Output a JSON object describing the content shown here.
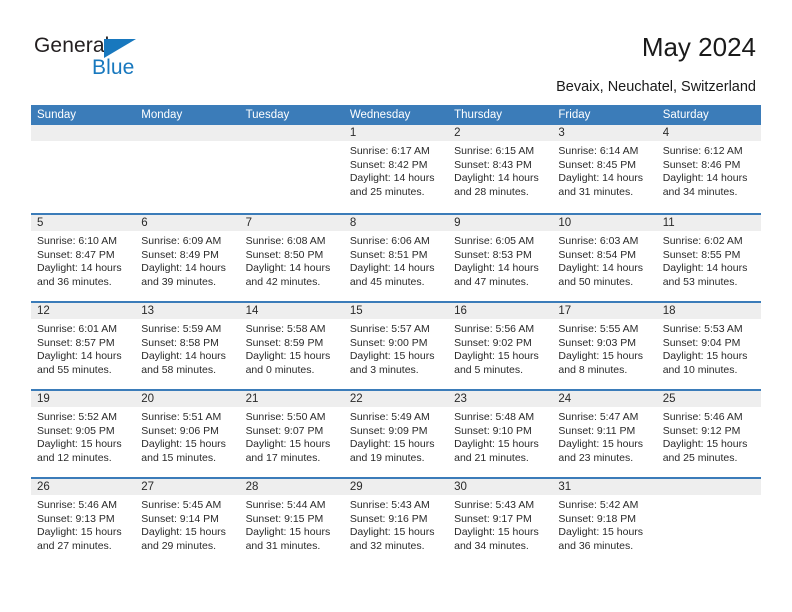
{
  "brand": {
    "name_part1": "General",
    "name_part2": "Blue",
    "accent_color": "#1878be",
    "triangle_icon": "triangle-icon"
  },
  "header": {
    "title": "May 2024",
    "subtitle": "Bevaix, Neuchatel, Switzerland",
    "header_bg_color": "#3b7cb9"
  },
  "calendar": {
    "day_headers": [
      "Sunday",
      "Monday",
      "Tuesday",
      "Wednesday",
      "Thursday",
      "Friday",
      "Saturday"
    ],
    "weeks": [
      [
        {
          "day": "",
          "sunrise": "",
          "sunset": "",
          "daylight1": "",
          "daylight2": ""
        },
        {
          "day": "",
          "sunrise": "",
          "sunset": "",
          "daylight1": "",
          "daylight2": ""
        },
        {
          "day": "",
          "sunrise": "",
          "sunset": "",
          "daylight1": "",
          "daylight2": ""
        },
        {
          "day": "1",
          "sunrise": "Sunrise: 6:17 AM",
          "sunset": "Sunset: 8:42 PM",
          "daylight1": "Daylight: 14 hours",
          "daylight2": "and 25 minutes."
        },
        {
          "day": "2",
          "sunrise": "Sunrise: 6:15 AM",
          "sunset": "Sunset: 8:43 PM",
          "daylight1": "Daylight: 14 hours",
          "daylight2": "and 28 minutes."
        },
        {
          "day": "3",
          "sunrise": "Sunrise: 6:14 AM",
          "sunset": "Sunset: 8:45 PM",
          "daylight1": "Daylight: 14 hours",
          "daylight2": "and 31 minutes."
        },
        {
          "day": "4",
          "sunrise": "Sunrise: 6:12 AM",
          "sunset": "Sunset: 8:46 PM",
          "daylight1": "Daylight: 14 hours",
          "daylight2": "and 34 minutes."
        }
      ],
      [
        {
          "day": "5",
          "sunrise": "Sunrise: 6:10 AM",
          "sunset": "Sunset: 8:47 PM",
          "daylight1": "Daylight: 14 hours",
          "daylight2": "and 36 minutes."
        },
        {
          "day": "6",
          "sunrise": "Sunrise: 6:09 AM",
          "sunset": "Sunset: 8:49 PM",
          "daylight1": "Daylight: 14 hours",
          "daylight2": "and 39 minutes."
        },
        {
          "day": "7",
          "sunrise": "Sunrise: 6:08 AM",
          "sunset": "Sunset: 8:50 PM",
          "daylight1": "Daylight: 14 hours",
          "daylight2": "and 42 minutes."
        },
        {
          "day": "8",
          "sunrise": "Sunrise: 6:06 AM",
          "sunset": "Sunset: 8:51 PM",
          "daylight1": "Daylight: 14 hours",
          "daylight2": "and 45 minutes."
        },
        {
          "day": "9",
          "sunrise": "Sunrise: 6:05 AM",
          "sunset": "Sunset: 8:53 PM",
          "daylight1": "Daylight: 14 hours",
          "daylight2": "and 47 minutes."
        },
        {
          "day": "10",
          "sunrise": "Sunrise: 6:03 AM",
          "sunset": "Sunset: 8:54 PM",
          "daylight1": "Daylight: 14 hours",
          "daylight2": "and 50 minutes."
        },
        {
          "day": "11",
          "sunrise": "Sunrise: 6:02 AM",
          "sunset": "Sunset: 8:55 PM",
          "daylight1": "Daylight: 14 hours",
          "daylight2": "and 53 minutes."
        }
      ],
      [
        {
          "day": "12",
          "sunrise": "Sunrise: 6:01 AM",
          "sunset": "Sunset: 8:57 PM",
          "daylight1": "Daylight: 14 hours",
          "daylight2": "and 55 minutes."
        },
        {
          "day": "13",
          "sunrise": "Sunrise: 5:59 AM",
          "sunset": "Sunset: 8:58 PM",
          "daylight1": "Daylight: 14 hours",
          "daylight2": "and 58 minutes."
        },
        {
          "day": "14",
          "sunrise": "Sunrise: 5:58 AM",
          "sunset": "Sunset: 8:59 PM",
          "daylight1": "Daylight: 15 hours",
          "daylight2": "and 0 minutes."
        },
        {
          "day": "15",
          "sunrise": "Sunrise: 5:57 AM",
          "sunset": "Sunset: 9:00 PM",
          "daylight1": "Daylight: 15 hours",
          "daylight2": "and 3 minutes."
        },
        {
          "day": "16",
          "sunrise": "Sunrise: 5:56 AM",
          "sunset": "Sunset: 9:02 PM",
          "daylight1": "Daylight: 15 hours",
          "daylight2": "and 5 minutes."
        },
        {
          "day": "17",
          "sunrise": "Sunrise: 5:55 AM",
          "sunset": "Sunset: 9:03 PM",
          "daylight1": "Daylight: 15 hours",
          "daylight2": "and 8 minutes."
        },
        {
          "day": "18",
          "sunrise": "Sunrise: 5:53 AM",
          "sunset": "Sunset: 9:04 PM",
          "daylight1": "Daylight: 15 hours",
          "daylight2": "and 10 minutes."
        }
      ],
      [
        {
          "day": "19",
          "sunrise": "Sunrise: 5:52 AM",
          "sunset": "Sunset: 9:05 PM",
          "daylight1": "Daylight: 15 hours",
          "daylight2": "and 12 minutes."
        },
        {
          "day": "20",
          "sunrise": "Sunrise: 5:51 AM",
          "sunset": "Sunset: 9:06 PM",
          "daylight1": "Daylight: 15 hours",
          "daylight2": "and 15 minutes."
        },
        {
          "day": "21",
          "sunrise": "Sunrise: 5:50 AM",
          "sunset": "Sunset: 9:07 PM",
          "daylight1": "Daylight: 15 hours",
          "daylight2": "and 17 minutes."
        },
        {
          "day": "22",
          "sunrise": "Sunrise: 5:49 AM",
          "sunset": "Sunset: 9:09 PM",
          "daylight1": "Daylight: 15 hours",
          "daylight2": "and 19 minutes."
        },
        {
          "day": "23",
          "sunrise": "Sunrise: 5:48 AM",
          "sunset": "Sunset: 9:10 PM",
          "daylight1": "Daylight: 15 hours",
          "daylight2": "and 21 minutes."
        },
        {
          "day": "24",
          "sunrise": "Sunrise: 5:47 AM",
          "sunset": "Sunset: 9:11 PM",
          "daylight1": "Daylight: 15 hours",
          "daylight2": "and 23 minutes."
        },
        {
          "day": "25",
          "sunrise": "Sunrise: 5:46 AM",
          "sunset": "Sunset: 9:12 PM",
          "daylight1": "Daylight: 15 hours",
          "daylight2": "and 25 minutes."
        }
      ],
      [
        {
          "day": "26",
          "sunrise": "Sunrise: 5:46 AM",
          "sunset": "Sunset: 9:13 PM",
          "daylight1": "Daylight: 15 hours",
          "daylight2": "and 27 minutes."
        },
        {
          "day": "27",
          "sunrise": "Sunrise: 5:45 AM",
          "sunset": "Sunset: 9:14 PM",
          "daylight1": "Daylight: 15 hours",
          "daylight2": "and 29 minutes."
        },
        {
          "day": "28",
          "sunrise": "Sunrise: 5:44 AM",
          "sunset": "Sunset: 9:15 PM",
          "daylight1": "Daylight: 15 hours",
          "daylight2": "and 31 minutes."
        },
        {
          "day": "29",
          "sunrise": "Sunrise: 5:43 AM",
          "sunset": "Sunset: 9:16 PM",
          "daylight1": "Daylight: 15 hours",
          "daylight2": "and 32 minutes."
        },
        {
          "day": "30",
          "sunrise": "Sunrise: 5:43 AM",
          "sunset": "Sunset: 9:17 PM",
          "daylight1": "Daylight: 15 hours",
          "daylight2": "and 34 minutes."
        },
        {
          "day": "31",
          "sunrise": "Sunrise: 5:42 AM",
          "sunset": "Sunset: 9:18 PM",
          "daylight1": "Daylight: 15 hours",
          "daylight2": "and 36 minutes."
        },
        {
          "day": "",
          "sunrise": "",
          "sunset": "",
          "daylight1": "",
          "daylight2": ""
        }
      ]
    ]
  }
}
